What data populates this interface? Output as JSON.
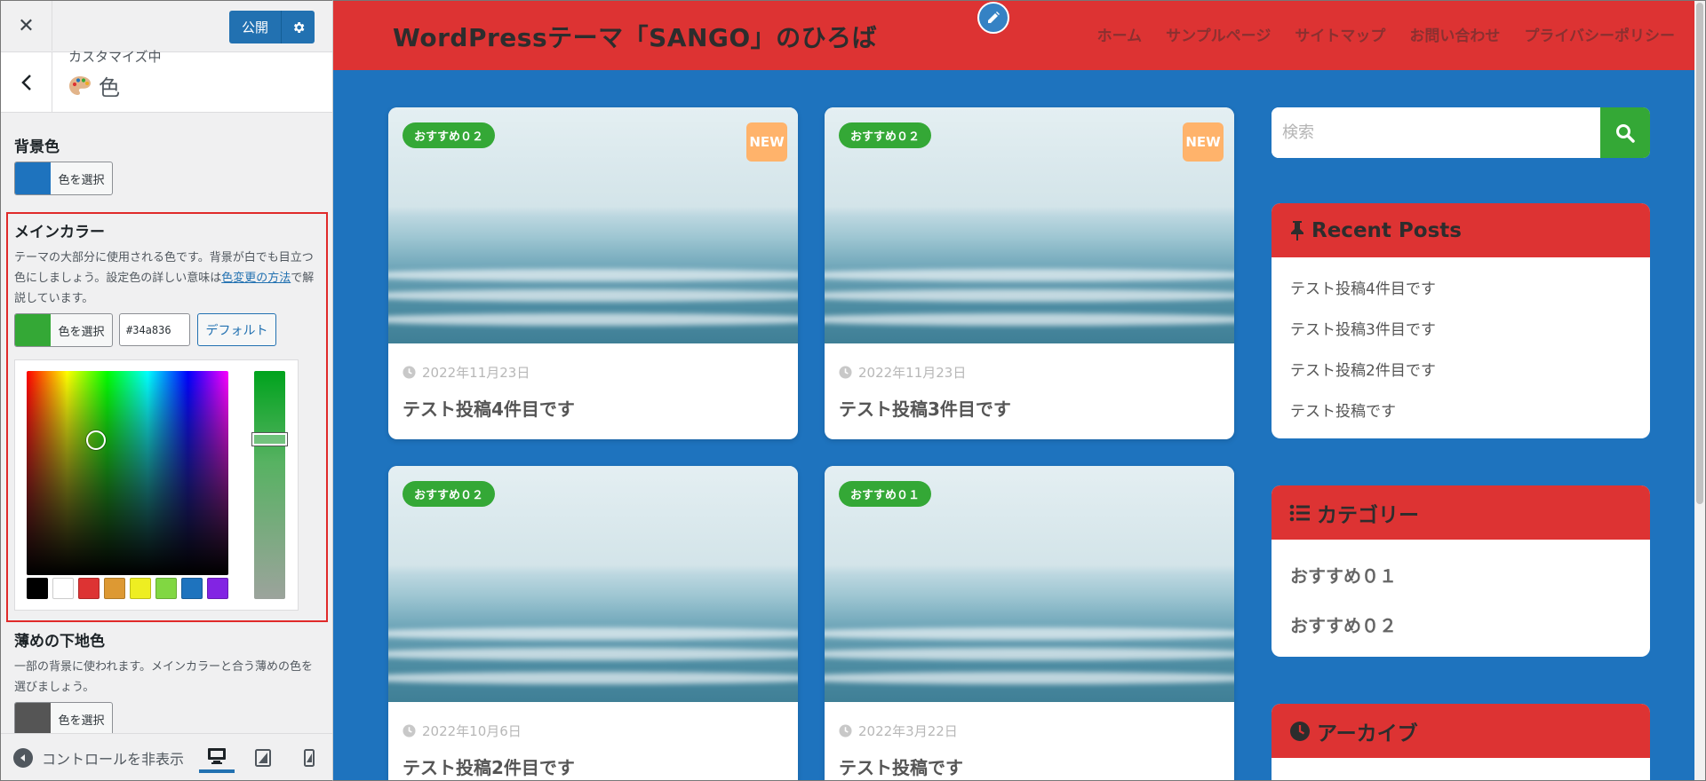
{
  "customizer": {
    "close_symbol": "✕",
    "publish_label": "公開",
    "customizing_label": "カスタマイズ中",
    "section_title": "色",
    "controls": {
      "background": {
        "title": "背景色",
        "button_label": "色を選択",
        "swatch": "#1e73be"
      },
      "main_color": {
        "title": "メインカラー",
        "desc_before": "テーマの大部分に使用される色です。背景が白でも目立つ色にしましょう。設定色の詳しい意味は",
        "desc_link": "色変更の方法",
        "desc_after": "で解説しています。",
        "button_label": "色を選択",
        "swatch": "#34a836",
        "hex_value": "#34a836",
        "default_label": "デフォルト",
        "palette": [
          "#000000",
          "#ffffff",
          "#dd3333",
          "#dd9933",
          "#eeee22",
          "#81d742",
          "#1e73be",
          "#8224e3"
        ]
      },
      "light_base": {
        "title": "薄めの下地色",
        "desc": "一部の背景に使われます。メインカラーと合う薄めの色を選びましょう。",
        "button_label": "色を選択",
        "swatch": "#555555"
      }
    },
    "footer": {
      "collapse_label": "コントロールを非表示"
    }
  },
  "preview": {
    "site_title": "WordPressテーマ「SANGO」のひろば",
    "nav": [
      "ホーム",
      "サンプルページ",
      "サイトマップ",
      "お問い合わせ",
      "プライバシーポリシー"
    ],
    "posts": [
      {
        "category": "おすすめ０２",
        "new": "NEW",
        "date": "2022年11月23日",
        "title": "テスト投稿4件目です"
      },
      {
        "category": "おすすめ０２",
        "new": "NEW",
        "date": "2022年11月23日",
        "title": "テスト投稿3件目です"
      },
      {
        "category": "おすすめ０２",
        "new": "",
        "date": "2022年10月6日",
        "title": "テスト投稿2件目です"
      },
      {
        "category": "おすすめ０１",
        "new": "",
        "date": "2022年3月22日",
        "title": "テスト投稿です"
      }
    ],
    "search_placeholder": "検索",
    "widgets": {
      "recent": {
        "title": "Recent Posts",
        "items": [
          "テスト投稿4件目です",
          "テスト投稿3件目です",
          "テスト投稿2件目です",
          "テスト投稿です"
        ]
      },
      "categories": {
        "title": "カテゴリー",
        "items": [
          "おすすめ０１",
          "おすすめ０２"
        ]
      },
      "archive": {
        "title": "アーカイブ"
      }
    },
    "colors": {
      "header": "#dd3333",
      "background": "#1e73be",
      "accent": "#34a836"
    }
  }
}
